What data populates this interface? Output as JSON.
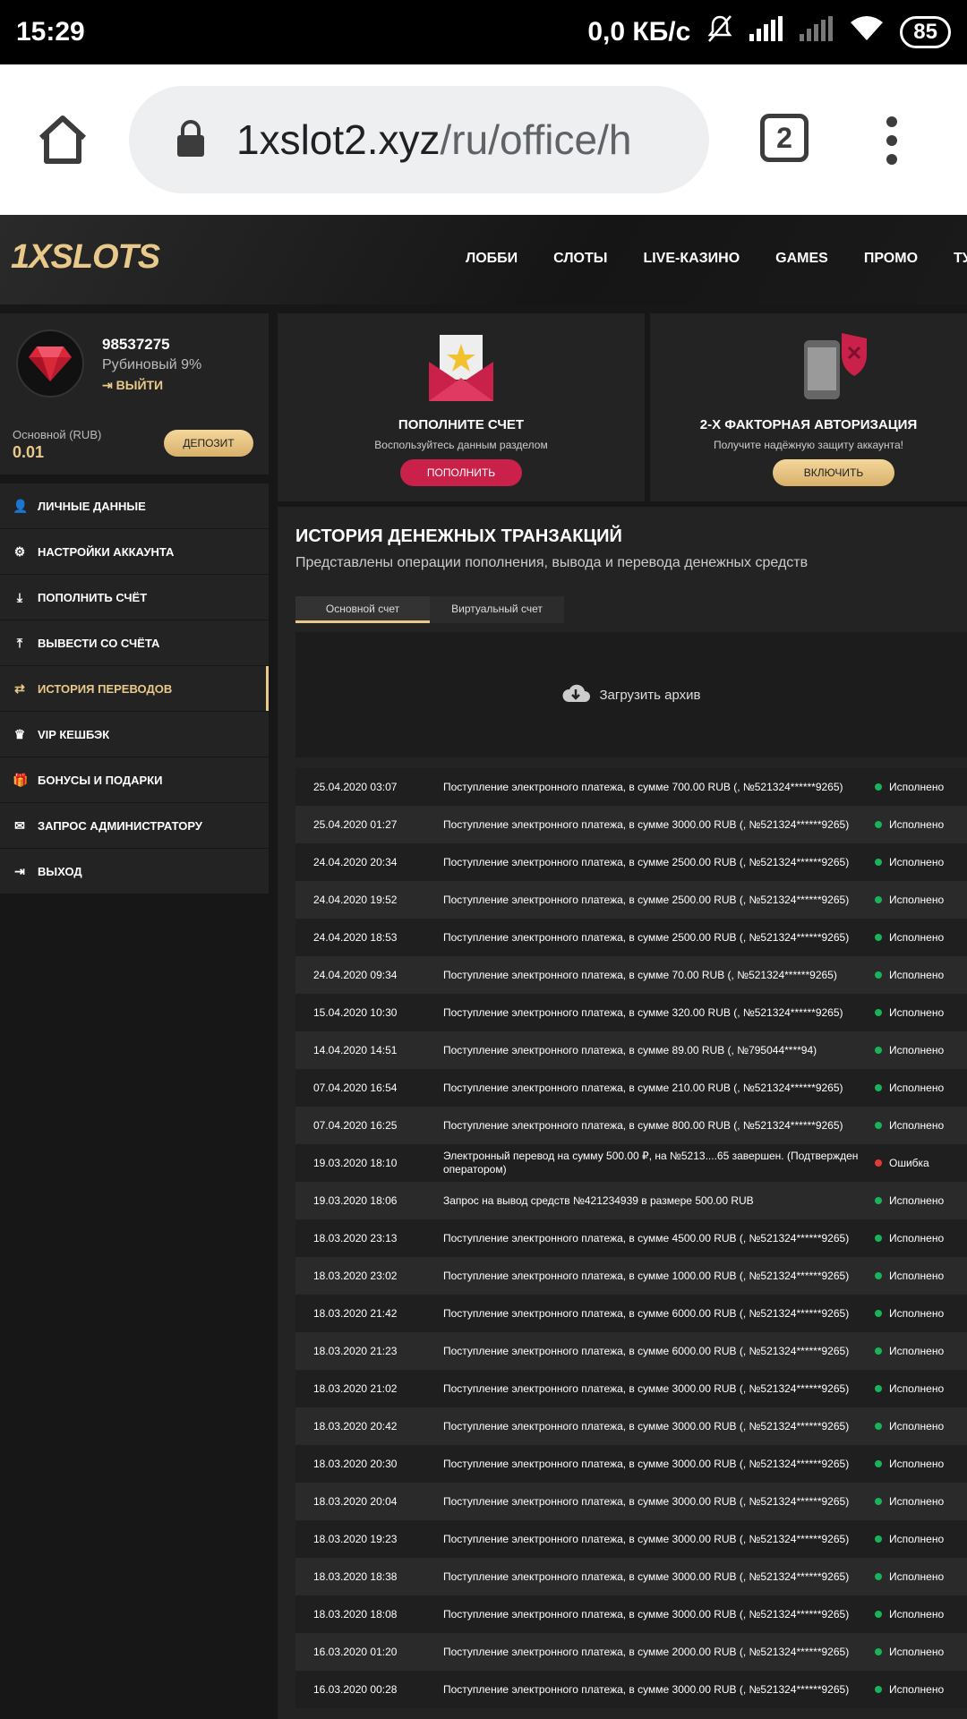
{
  "statusbar": {
    "time": "15:29",
    "speed": "0,0 КБ/с",
    "battery": "85"
  },
  "browser": {
    "url_host": "1xslot2.xyz",
    "url_path": "/ru/office/h",
    "tab_count": "2"
  },
  "site": {
    "logo": "1XSLOTS",
    "nav": [
      "ЛОББИ",
      "СЛОТЫ",
      "LIVE-КАЗИНО",
      "GAMES",
      "ПРОМО",
      "ТУРНИ"
    ]
  },
  "profile": {
    "id": "98537275",
    "level": "Рубиновый 9%",
    "logout": "ВЫЙТИ",
    "balance_label": "Основной (RUB)",
    "balance_value": "0.01",
    "deposit_label": "ДЕПОЗИТ"
  },
  "menu": [
    {
      "label": "ЛИЧНЫЕ ДАННЫЕ",
      "icon": "user-plus-icon"
    },
    {
      "label": "НАСТРОЙКИ АККАУНТА",
      "icon": "cogs-icon"
    },
    {
      "label": "ПОПОЛНИТЬ СЧЁТ",
      "icon": "download-icon"
    },
    {
      "label": "ВЫВЕСТИ СО СЧЁТА",
      "icon": "upload-icon"
    },
    {
      "label": "ИСТОРИЯ ПЕРЕВОДОВ",
      "icon": "transfer-icon"
    },
    {
      "label": "VIP КЕШБЭК",
      "icon": "crown-icon"
    },
    {
      "label": "БОНУСЫ И ПОДАРКИ",
      "icon": "gift-icon"
    },
    {
      "label": "ЗАПРОС АДМИНИСТРАТОРУ",
      "icon": "envelope-icon"
    },
    {
      "label": "ВЫХОД",
      "icon": "sign-out-icon"
    }
  ],
  "cards": {
    "deposit": {
      "title": "ПОПОЛНИТЕ СЧЕТ",
      "subtitle": "Воспользуйтесь данным разделом",
      "button": "ПОПОЛНИТЬ"
    },
    "twofa": {
      "title": "2-Х ФАКТОРНАЯ АВТОРИЗАЦИЯ",
      "subtitle": "Получите надёжную защиту аккаунта!",
      "button": "ВКЛЮЧИТЬ"
    }
  },
  "history": {
    "title": "ИСТОРИЯ ДЕНЕЖНЫХ ТРАНЗАКЦИЙ",
    "subtitle": "Представлены операции пополнения, вывода и перевода денежных средств",
    "tabs": [
      "Основной счет",
      "Виртуальный счет"
    ],
    "archive_label": "Загрузить архив",
    "rows": [
      {
        "date": "25.04.2020 03:07",
        "desc": "Поступление электронного платежа, в сумме 700.00 RUB (, №521324******9265)",
        "status": "Исполнено",
        "ok": true
      },
      {
        "date": "25.04.2020 01:27",
        "desc": "Поступление электронного платежа, в сумме 3000.00 RUB (, №521324******9265)",
        "status": "Исполнено",
        "ok": true
      },
      {
        "date": "24.04.2020 20:34",
        "desc": "Поступление электронного платежа, в сумме 2500.00 RUB (, №521324******9265)",
        "status": "Исполнено",
        "ok": true
      },
      {
        "date": "24.04.2020 19:52",
        "desc": "Поступление электронного платежа, в сумме 2500.00 RUB (, №521324******9265)",
        "status": "Исполнено",
        "ok": true
      },
      {
        "date": "24.04.2020 18:53",
        "desc": "Поступление электронного платежа, в сумме 2500.00 RUB (, №521324******9265)",
        "status": "Исполнено",
        "ok": true
      },
      {
        "date": "24.04.2020 09:34",
        "desc": "Поступление электронного платежа, в сумме 70.00 RUB (, №521324******9265)",
        "status": "Исполнено",
        "ok": true
      },
      {
        "date": "15.04.2020 10:30",
        "desc": "Поступление электронного платежа, в сумме 320.00 RUB (, №521324******9265)",
        "status": "Исполнено",
        "ok": true
      },
      {
        "date": "14.04.2020 14:51",
        "desc": "Поступление электронного платежа, в сумме 89.00 RUB (, №795044****94)",
        "status": "Исполнено",
        "ok": true
      },
      {
        "date": "07.04.2020 16:54",
        "desc": "Поступление электронного платежа, в сумме 210.00 RUB (, №521324******9265)",
        "status": "Исполнено",
        "ok": true
      },
      {
        "date": "07.04.2020 16:25",
        "desc": "Поступление электронного платежа, в сумме 800.00 RUB (, №521324******9265)",
        "status": "Исполнено",
        "ok": true
      },
      {
        "date": "19.03.2020 18:10",
        "desc": "Электронный перевод на сумму 500.00 ₽, на №5213....65 завершен. (Подтвержден оператором)",
        "status": "Ошибка",
        "ok": false
      },
      {
        "date": "19.03.2020 18:06",
        "desc": "Запрос на вывод средств №421234939 в размере 500.00 RUB",
        "status": "Исполнено",
        "ok": true
      },
      {
        "date": "18.03.2020 23:13",
        "desc": "Поступление электронного платежа, в сумме 4500.00 RUB (, №521324******9265)",
        "status": "Исполнено",
        "ok": true
      },
      {
        "date": "18.03.2020 23:02",
        "desc": "Поступление электронного платежа, в сумме 1000.00 RUB (, №521324******9265)",
        "status": "Исполнено",
        "ok": true
      },
      {
        "date": "18.03.2020 21:42",
        "desc": "Поступление электронного платежа, в сумме 6000.00 RUB (, №521324******9265)",
        "status": "Исполнено",
        "ok": true
      },
      {
        "date": "18.03.2020 21:23",
        "desc": "Поступление электронного платежа, в сумме 6000.00 RUB (, №521324******9265)",
        "status": "Исполнено",
        "ok": true
      },
      {
        "date": "18.03.2020 21:02",
        "desc": "Поступление электронного платежа, в сумме 3000.00 RUB (, №521324******9265)",
        "status": "Исполнено",
        "ok": true
      },
      {
        "date": "18.03.2020 20:42",
        "desc": "Поступление электронного платежа, в сумме 3000.00 RUB (, №521324******9265)",
        "status": "Исполнено",
        "ok": true
      },
      {
        "date": "18.03.2020 20:30",
        "desc": "Поступление электронного платежа, в сумме 3000.00 RUB (, №521324******9265)",
        "status": "Исполнено",
        "ok": true
      },
      {
        "date": "18.03.2020 20:04",
        "desc": "Поступление электронного платежа, в сумме 3000.00 RUB (, №521324******9265)",
        "status": "Исполнено",
        "ok": true
      },
      {
        "date": "18.03.2020 19:23",
        "desc": "Поступление электронного платежа, в сумме 3000.00 RUB (, №521324******9265)",
        "status": "Исполнено",
        "ok": true
      },
      {
        "date": "18.03.2020 18:38",
        "desc": "Поступление электронного платежа, в сумме 3000.00 RUB (, №521324******9265)",
        "status": "Исполнено",
        "ok": true
      },
      {
        "date": "18.03.2020 18:08",
        "desc": "Поступление электронного платежа, в сумме 3000.00 RUB (, №521324******9265)",
        "status": "Исполнено",
        "ok": true
      },
      {
        "date": "16.03.2020 01:20",
        "desc": "Поступление электронного платежа, в сумме 2000.00 RUB (, №521324******9265)",
        "status": "Исполнено",
        "ok": true
      },
      {
        "date": "16.03.2020 00:28",
        "desc": "Поступление электронного платежа, в сумме 3000.00 RUB (, №521324******9265)",
        "status": "Исполнено",
        "ok": true
      }
    ]
  }
}
